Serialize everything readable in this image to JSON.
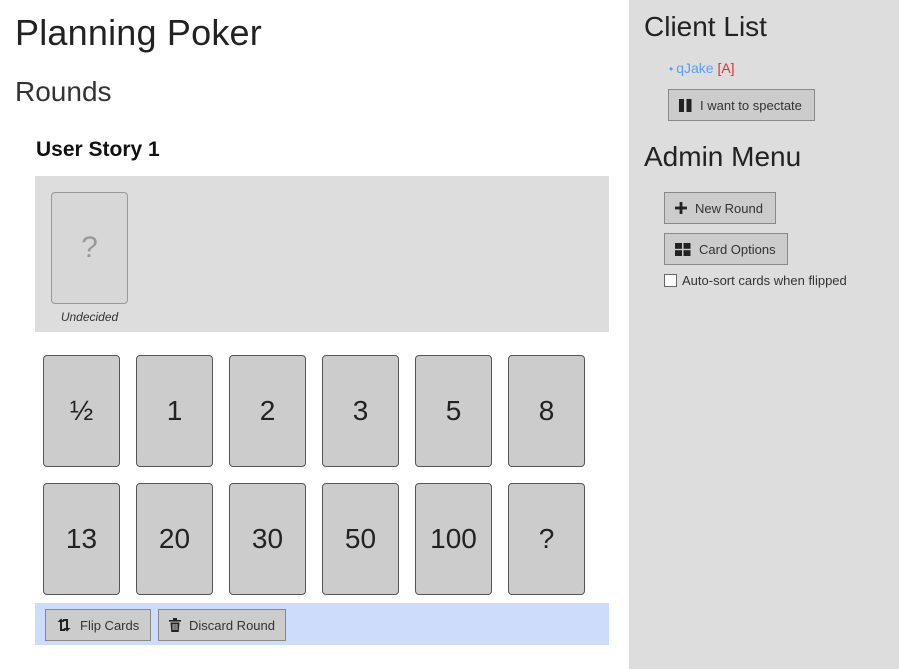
{
  "main": {
    "title": "Planning Poker",
    "section_title": "Rounds",
    "round": {
      "story_title": "User Story 1",
      "played_cards": [
        {
          "value": "?",
          "player_label": "Undecided"
        }
      ]
    },
    "deck": {
      "cards": [
        "½",
        "1",
        "2",
        "3",
        "5",
        "8",
        "13",
        "20",
        "30",
        "50",
        "100",
        "?"
      ]
    },
    "actions": {
      "flip_label": "Flip Cards",
      "discard_label": "Discard Round"
    }
  },
  "sidebar": {
    "client_list_title": "Client List",
    "clients": [
      {
        "bullet": "•",
        "name": "qJake",
        "tag": "[A]"
      }
    ],
    "spectate_label": "I want to spectate",
    "admin_menu_title": "Admin Menu",
    "new_round_label": "New Round",
    "card_options_label": "Card Options",
    "autosort_label": "Auto-sort cards when flipped",
    "autosort_checked": false
  }
}
